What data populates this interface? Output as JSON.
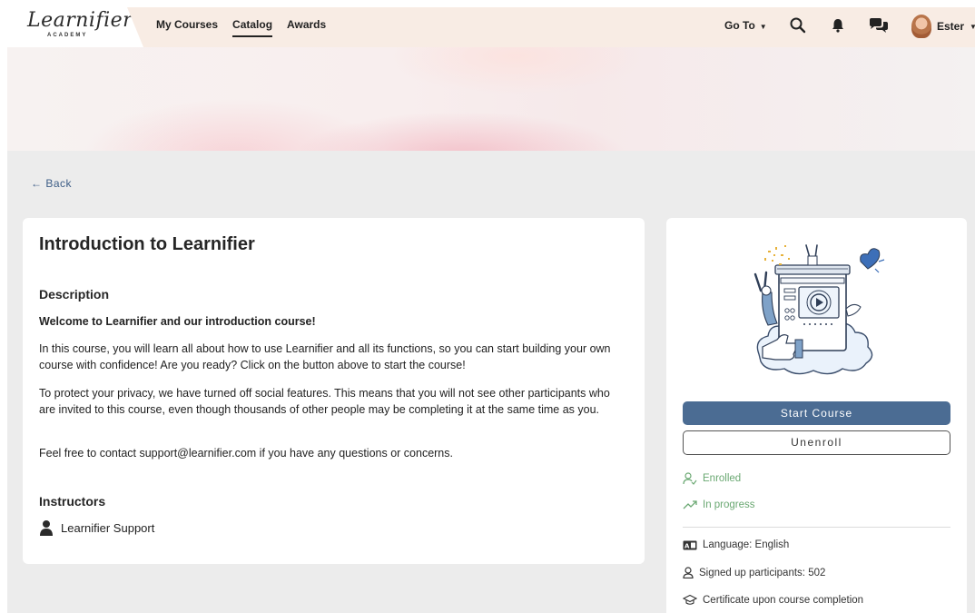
{
  "nav": {
    "logo": "Learnifier",
    "logo_sub": "ACADEMY",
    "links": [
      "My Courses",
      "Catalog",
      "Awards"
    ],
    "goto": "Go To",
    "user_name": "Ester"
  },
  "back": "← Back",
  "course": {
    "title": "Introduction to Learnifier",
    "description_heading": "Description",
    "welcome": "Welcome to Learnifier and our introduction course!",
    "para1": "In this course, you will learn all about how to use Learnifier and all its functions, so you can start building your own course with confidence! Are you ready? Click on the button above to start the course!",
    "para2": "To protect your privacy, we have turned off social features. This means that you will not see other participants who are invited to this course, even though thousands of other people may be completing it at the same time as you.",
    "para3": "Feel free to contact support@learnifier.com if you have any questions or concerns.",
    "instructors_heading": "Instructors",
    "instructor": "Learnifier Support"
  },
  "side": {
    "start_label": "Start Course",
    "unenroll_label": "Unenroll",
    "enrolled": "Enrolled",
    "progress": "In progress",
    "language": "Language: English",
    "participants": "Signed up participants: 502",
    "certificate": "Certificate upon course completion"
  },
  "colors": {
    "primary_button": "#4b6c93",
    "status_green": "#6aa872",
    "link_blue": "#3d5d86"
  }
}
